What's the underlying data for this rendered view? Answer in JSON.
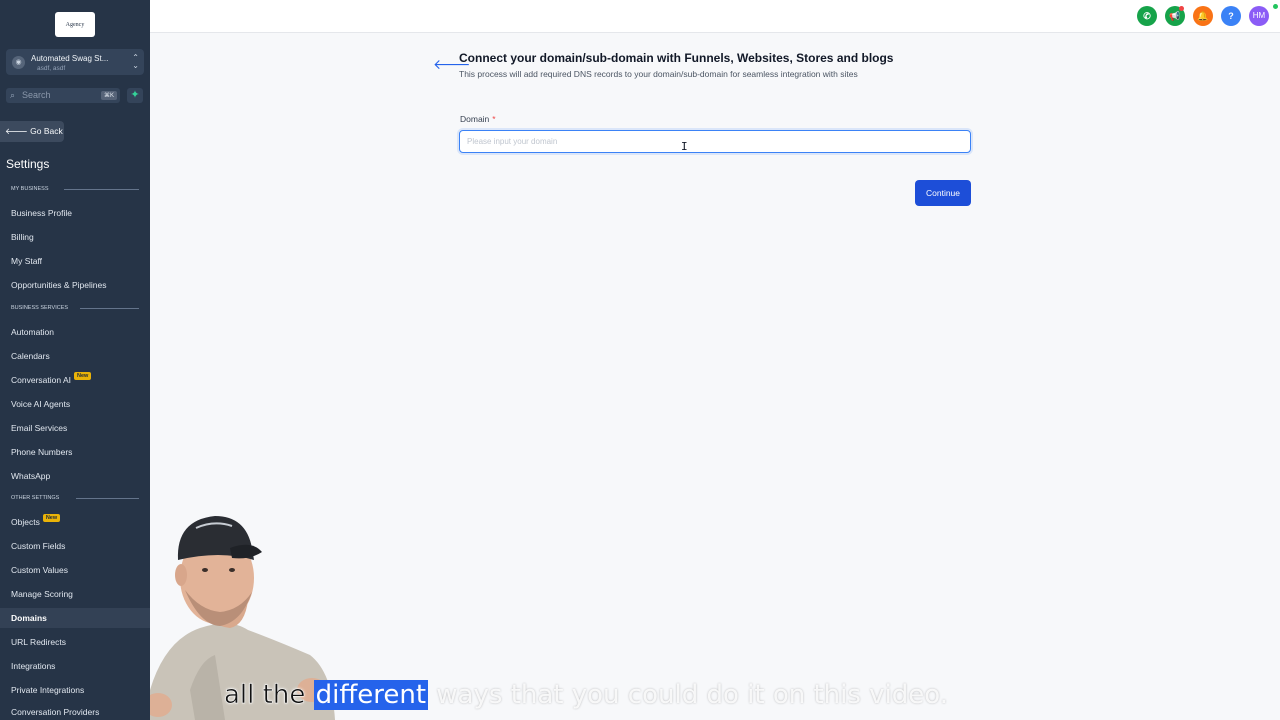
{
  "sidebar": {
    "logo_text": "Agency",
    "account": {
      "name": "Automated Swag St...",
      "sub": "asdf, asdf"
    },
    "search": {
      "placeholder": "Search",
      "shortcut": "⌘K"
    },
    "go_back": "Go Back",
    "title": "Settings",
    "sections": [
      {
        "label": "MY BUSINESS"
      },
      {
        "label": "BUSINESS SERVICES"
      },
      {
        "label": "OTHER SETTINGS"
      }
    ],
    "items": [
      {
        "label": "Business Profile"
      },
      {
        "label": "Billing"
      },
      {
        "label": "My Staff"
      },
      {
        "label": "Opportunities & Pipelines"
      },
      {
        "label": "Automation"
      },
      {
        "label": "Calendars"
      },
      {
        "label": "Conversation AI",
        "badge": "New"
      },
      {
        "label": "Voice AI Agents"
      },
      {
        "label": "Email Services"
      },
      {
        "label": "Phone Numbers"
      },
      {
        "label": "WhatsApp"
      },
      {
        "label": "Objects",
        "badge": "New"
      },
      {
        "label": "Custom Fields"
      },
      {
        "label": "Custom Values"
      },
      {
        "label": "Manage Scoring"
      },
      {
        "label": "Domains",
        "active": true
      },
      {
        "label": "URL Redirects"
      },
      {
        "label": "Integrations"
      },
      {
        "label": "Private Integrations"
      },
      {
        "label": "Conversation Providers"
      }
    ]
  },
  "topbar": {
    "icons": [
      {
        "name": "phone-icon",
        "color": "#16a34a"
      },
      {
        "name": "megaphone-icon",
        "color": "#16a34a"
      },
      {
        "name": "bell-icon",
        "color": "#f97316"
      },
      {
        "name": "help-icon",
        "color": "#3b82f6",
        "glyph": "?"
      }
    ],
    "user_initials": "HM",
    "user_color": "#8b5cf6"
  },
  "main": {
    "title": "Connect your domain/sub-domain with Funnels, Websites, Stores and blogs",
    "subtitle": "This process will add required DNS records to your domain/sub-domain for seamless integration with sites",
    "domain_label": "Domain",
    "required_mark": "*",
    "domain_placeholder": "Please input your domain",
    "domain_value": "",
    "continue_label": "Continue"
  },
  "caption": {
    "before": "all the",
    "highlight": "different",
    "after": "ways that you could do it on this video."
  }
}
